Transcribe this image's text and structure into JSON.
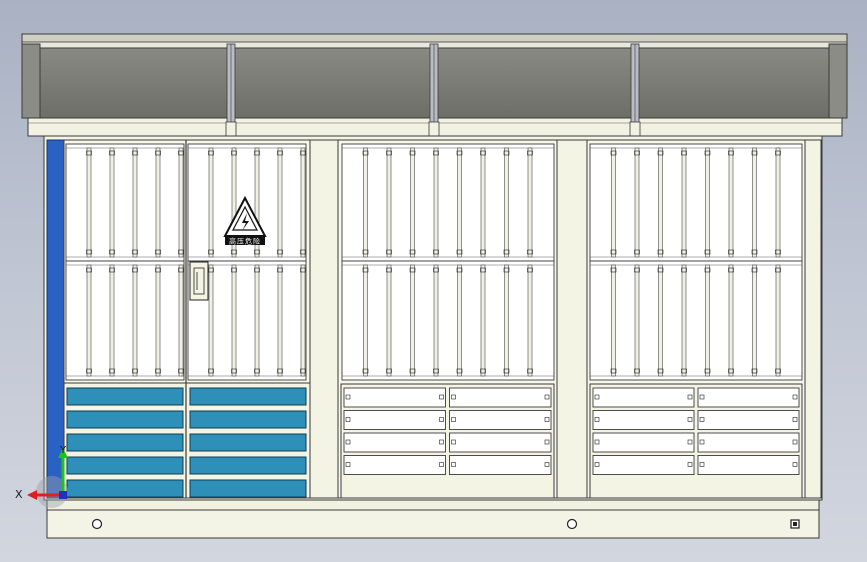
{
  "colors": {
    "background_top": "#a9b1c3",
    "background_bottom": "#d2d6df",
    "enclosure_body": "#f4f4e4",
    "roof_panel": "#7a7a74",
    "outline": "#3a3a3a",
    "louver_fill": "#ffffff",
    "blue_strip": "#2a62c4",
    "teal_vent": "#2e8fb8",
    "axis_x": "#e02020",
    "axis_y": "#20c020"
  },
  "warning_sign": {
    "icon": "high-voltage-warning-triangle",
    "caption": "高压危险"
  },
  "axis_triad": {
    "x_label": "X",
    "y_label": "Y"
  },
  "structure": {
    "roof_sections": 4,
    "door_bays": 3,
    "left_bay_vent_rows": 5,
    "right_bays_lower_panel_rows": 4
  }
}
